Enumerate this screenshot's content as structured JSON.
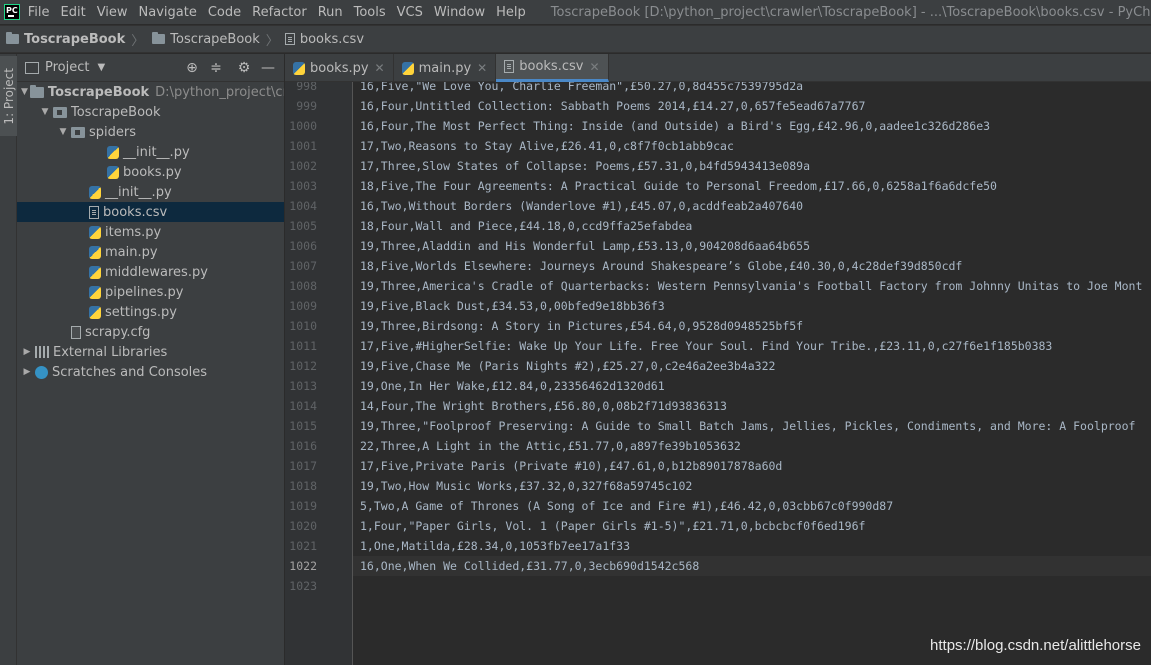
{
  "menubar": {
    "items": [
      "File",
      "Edit",
      "View",
      "Navigate",
      "Code",
      "Refactor",
      "Run",
      "Tools",
      "VCS",
      "Window",
      "Help"
    ],
    "window_title": "ToscrapeBook [D:\\python_project\\crawler\\ToscrapeBook] - ...\\ToscrapeBook\\books.csv - PyCharm"
  },
  "navbar": {
    "crumbs": [
      "ToscrapeBook",
      "ToscrapeBook",
      "books.csv"
    ]
  },
  "toolstrip": {
    "project_label": "1: Project"
  },
  "project_panel": {
    "title": "Project",
    "tree": [
      {
        "label": "ToscrapeBook",
        "sub": "D:\\python_project\\crawler",
        "icon": "folder",
        "arrow": "down",
        "level": 0,
        "bold": true
      },
      {
        "label": "ToscrapeBook",
        "icon": "pkg",
        "arrow": "down",
        "level": 1
      },
      {
        "label": "spiders",
        "icon": "pkg",
        "arrow": "down",
        "level": 2
      },
      {
        "label": "__init__.py",
        "icon": "py",
        "level": 4
      },
      {
        "label": "books.py",
        "icon": "py",
        "level": 4
      },
      {
        "label": "__init__.py",
        "icon": "py",
        "level": 3
      },
      {
        "label": "books.csv",
        "icon": "csv",
        "level": 3,
        "selected": true
      },
      {
        "label": "items.py",
        "icon": "py",
        "level": 3
      },
      {
        "label": "main.py",
        "icon": "py",
        "level": 3
      },
      {
        "label": "middlewares.py",
        "icon": "py",
        "level": 3
      },
      {
        "label": "pipelines.py",
        "icon": "py",
        "level": 3
      },
      {
        "label": "settings.py",
        "icon": "py",
        "level": 3
      },
      {
        "label": "scrapy.cfg",
        "icon": "cfg",
        "level": 2
      },
      {
        "label": "External Libraries",
        "icon": "lib",
        "arrow": "right",
        "level": 0
      },
      {
        "label": "Scratches and Consoles",
        "icon": "scratch",
        "arrow": "right",
        "level": 0
      }
    ]
  },
  "editor": {
    "tabs": [
      {
        "label": "books.py",
        "icon": "py",
        "active": false
      },
      {
        "label": "main.py",
        "icon": "py",
        "active": false
      },
      {
        "label": "books.csv",
        "icon": "csv",
        "active": true
      }
    ],
    "current_line": "1022",
    "lines": [
      {
        "n": "998",
        "text": "16,Five,\"We Love You, Charlie Freeman\",£50.27,0,8d455c7539795d2a"
      },
      {
        "n": "999",
        "text": "16,Four,Untitled Collection: Sabbath Poems 2014,£14.27,0,657fe5ead67a7767"
      },
      {
        "n": "1000",
        "text": "16,Four,The Most Perfect Thing: Inside (and Outside) a Bird's Egg,£42.96,0,aadee1c326d286e3"
      },
      {
        "n": "1001",
        "text": "17,Two,Reasons to Stay Alive,£26.41,0,c8f7f0cb1abb9cac"
      },
      {
        "n": "1002",
        "text": "17,Three,Slow States of Collapse: Poems,£57.31,0,b4fd5943413e089a"
      },
      {
        "n": "1003",
        "text": "18,Five,The Four Agreements: A Practical Guide to Personal Freedom,£17.66,0,6258a1f6a6dcfe50"
      },
      {
        "n": "1004",
        "text": "16,Two,Without Borders (Wanderlove #1),£45.07,0,acddfeab2a407640"
      },
      {
        "n": "1005",
        "text": "18,Four,Wall and Piece,£44.18,0,ccd9ffa25efabdea"
      },
      {
        "n": "1006",
        "text": "19,Three,Aladdin and His Wonderful Lamp,£53.13,0,904208d6aa64b655"
      },
      {
        "n": "1007",
        "text": "18,Five,Worlds Elsewhere: Journeys Around Shakespeare’s Globe,£40.30,0,4c28def39d850cdf"
      },
      {
        "n": "1008",
        "text": "19,Three,America's Cradle of Quarterbacks: Western Pennsylvania's Football Factory from Johnny Unitas to Joe Mont"
      },
      {
        "n": "1009",
        "text": "19,Five,Black Dust,£34.53,0,00bfed9e18bb36f3"
      },
      {
        "n": "1010",
        "text": "19,Three,Birdsong: A Story in Pictures,£54.64,0,9528d0948525bf5f"
      },
      {
        "n": "1011",
        "text": "17,Five,#HigherSelfie: Wake Up Your Life. Free Your Soul. Find Your Tribe.,£23.11,0,c27f6e1f185b0383"
      },
      {
        "n": "1012",
        "text": "19,Five,Chase Me (Paris Nights #2),£25.27,0,c2e46a2ee3b4a322"
      },
      {
        "n": "1013",
        "text": "19,One,In Her Wake,£12.84,0,23356462d1320d61"
      },
      {
        "n": "1014",
        "text": "14,Four,The Wright Brothers,£56.80,0,08b2f71d93836313"
      },
      {
        "n": "1015",
        "text": "19,Three,\"Foolproof Preserving: A Guide to Small Batch Jams, Jellies, Pickles, Condiments, and More: A Foolproof"
      },
      {
        "n": "1016",
        "text": "22,Three,A Light in the Attic,£51.77,0,a897fe39b1053632"
      },
      {
        "n": "1017",
        "text": "17,Five,Private Paris (Private #10),£47.61,0,b12b89017878a60d"
      },
      {
        "n": "1018",
        "text": "19,Two,How Music Works,£37.32,0,327f68a59745c102"
      },
      {
        "n": "1019",
        "text": "5,Two,A Game of Thrones (A Song of Ice and Fire #1),£46.42,0,03cbb67c0f990d87"
      },
      {
        "n": "1020",
        "text": "1,Four,\"Paper Girls, Vol. 1 (Paper Girls #1-5)\",£21.71,0,bcbcbcf0f6ed196f"
      },
      {
        "n": "1021",
        "text": "1,One,Matilda,£28.34,0,1053fb7ee17a1f33"
      },
      {
        "n": "1022",
        "text": "16,One,When We Collided,£31.77,0,3ecb690d1542c568"
      },
      {
        "n": "1023",
        "text": ""
      }
    ]
  },
  "watermark": "https://blog.csdn.net/alittlehorse"
}
